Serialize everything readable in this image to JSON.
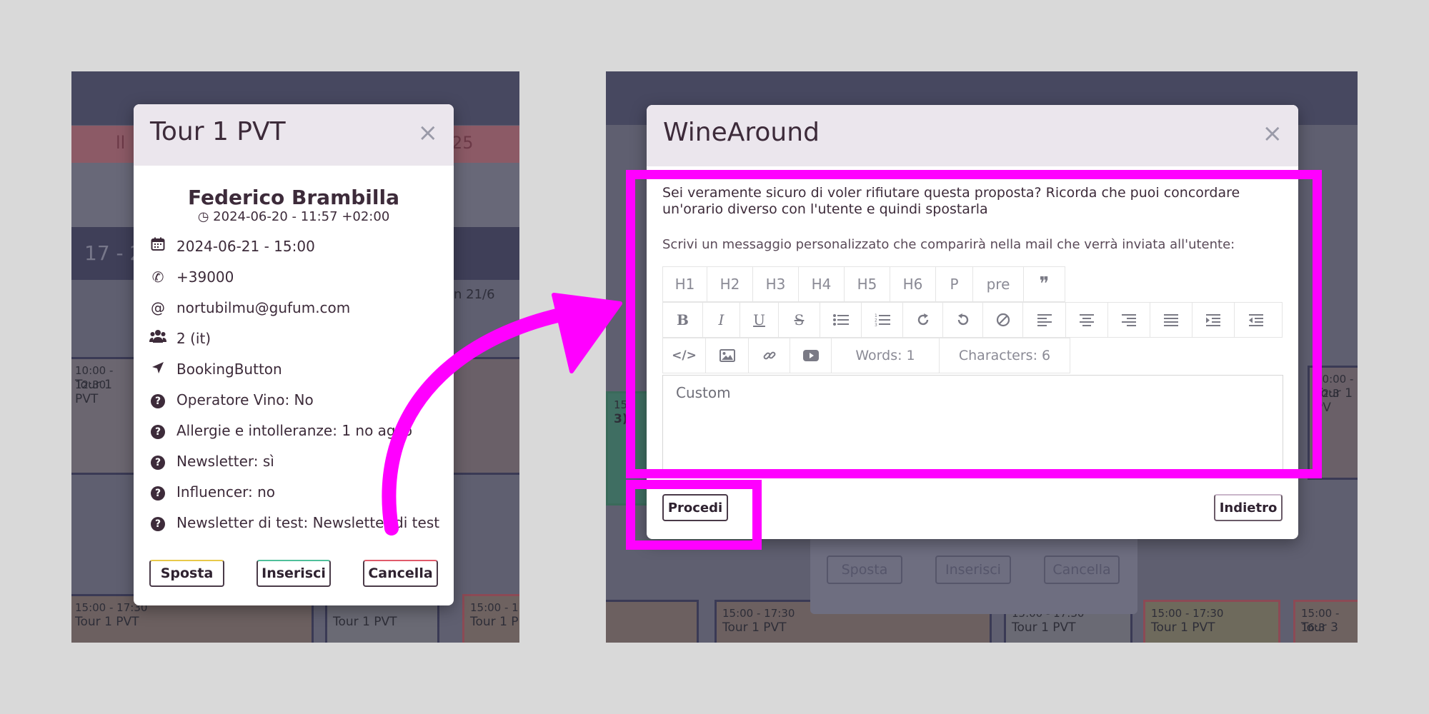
{
  "left": {
    "bg": {
      "header_fragment": "ll",
      "header_fragment_right": "25",
      "date_fragment": "17 - 2",
      "date_fragment_right": "n 21/6",
      "events": [
        {
          "time": "10:00 - 12:30",
          "title": "Tour 1 PVT"
        },
        {
          "time": "15:00 - 17:30",
          "title": "Tour 1 PVT"
        },
        {
          "time": "",
          "title": "Tour 1 PVT"
        },
        {
          "time": "15:00 - 17",
          "title": "Tour 1 P"
        }
      ]
    },
    "modal": {
      "title": "Tour 1 PVT",
      "close": "×",
      "guest_name": "Federico Brambilla",
      "created": "2024-06-20 - 11:57 +02:00",
      "rows": [
        {
          "icon": "calendar-icon",
          "text": "2024-06-21 - 15:00"
        },
        {
          "icon": "phone-icon",
          "text": "+39000"
        },
        {
          "icon": "at-icon",
          "text": "nortubilmu@gufum.com"
        },
        {
          "icon": "users-icon",
          "text": "2 (it)"
        },
        {
          "icon": "location-arrow-icon",
          "text": "BookingButton"
        },
        {
          "icon": "question-icon",
          "text": "Operatore Vino: No"
        },
        {
          "icon": "question-icon",
          "text": "Allergie e intolleranze: 1 no aglio"
        },
        {
          "icon": "question-icon",
          "text": "Newsletter: sì"
        },
        {
          "icon": "question-icon",
          "text": "Influencer: no"
        },
        {
          "icon": "question-icon",
          "text": "Newsletter di test: Newsletter di test"
        }
      ],
      "buttons": {
        "sposta": "Sposta",
        "inserisci": "Inserisci",
        "cancella": "Cancella"
      }
    }
  },
  "right": {
    "bg": {
      "events": [
        {
          "time": "15:00 - 17:30",
          "title": "Tour 1 PVT"
        },
        {
          "time": "15:00 - 17:30",
          "title": "Tour 1 PVT"
        },
        {
          "time": "15:00 - 17:30",
          "title": "Tour 1 PVT"
        },
        {
          "time": "15:00 - 16:3",
          "title": "Tour 3"
        },
        {
          "time": "10:00 - 12:3",
          "title": "Tour 1 PV"
        }
      ],
      "fragment_15": "15",
      "fragment_3": "3)",
      "ghost_buttons": {
        "sposta": "Sposta",
        "inserisci": "Inserisci",
        "cancella": "Cancella"
      }
    },
    "modal": {
      "title": "WineAround",
      "close": "×",
      "question": "Sei veramente sicuro di voler rifiutare questa proposta? Ricorda che puoi concordare un'orario diverso con l'utente e quindi spostarla",
      "instruction": "Scrivi un messaggio personalizzato che comparirà nella mail che verrà inviata all'utente:",
      "toolbar_headings": [
        "H1",
        "H2",
        "H3",
        "H4",
        "H5",
        "H6",
        "P",
        "pre",
        "❞"
      ],
      "words": "Words: 1",
      "characters": "Characters: 6",
      "editor_text": "Custom",
      "procedi": "Procedi",
      "indietro": "Indietro"
    }
  },
  "colors": {
    "highlight": "#ff00ff",
    "arrow": "#ff00ff",
    "sposta_border": "#e8c94a",
    "inserisci_border": "#4fbf9a",
    "cancella_border": "#e05a6a",
    "modal_header": "#ebe6ed"
  }
}
